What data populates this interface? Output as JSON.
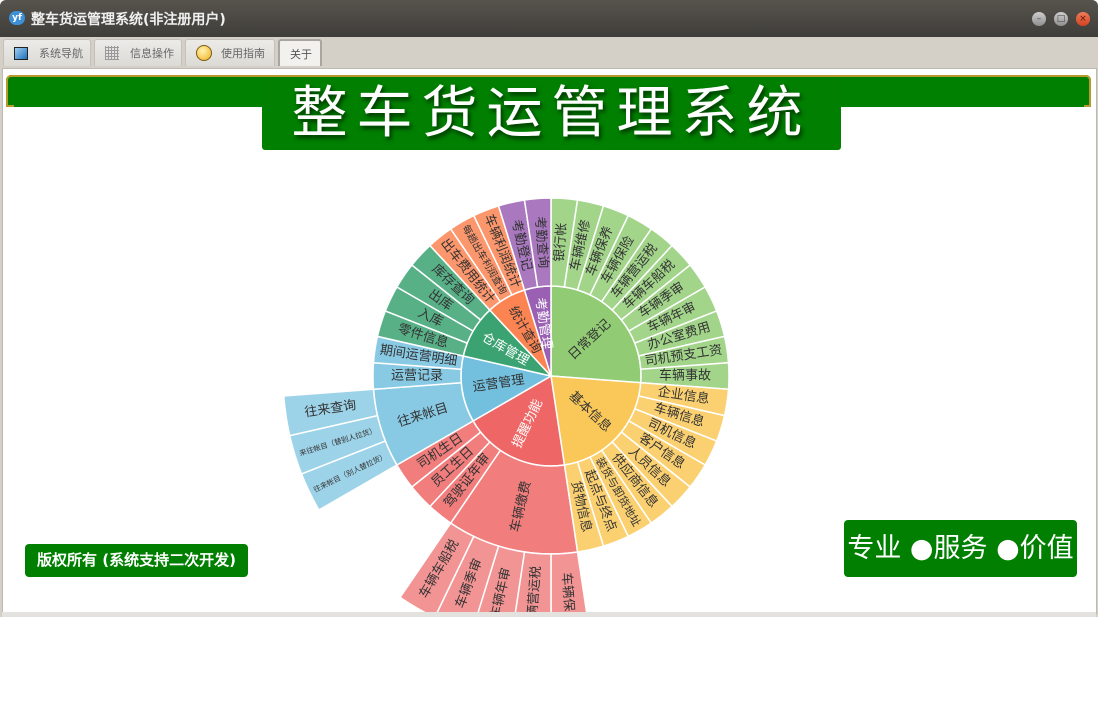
{
  "window": {
    "title": "整车货运管理系统(非注册用户)",
    "app_icon": "yf-cloud-icon",
    "controls": [
      "minimize",
      "maximize",
      "close"
    ]
  },
  "tabs": [
    {
      "label": "系统导航",
      "icon": "monitor-icon",
      "active": false
    },
    {
      "label": "信息操作",
      "icon": "grid-icon",
      "active": false
    },
    {
      "label": "使用指南",
      "icon": "help-coin-icon",
      "active": false
    },
    {
      "label": "关于",
      "icon": "",
      "active": true
    }
  ],
  "header": {
    "title": "整车货运管理系统"
  },
  "footer": {
    "copyright": "版权所有 (系统支持二次开发)",
    "slogan": "专业 ●服务 ●价值"
  },
  "colors": {
    "brand_green": "#007f00"
  },
  "chart_data": {
    "type": "sunburst",
    "title": "",
    "leaf_value": 1,
    "nodes": [
      {
        "name": "日常登记",
        "color": "#91cc75",
        "children": [
          {
            "name": "银行帐"
          },
          {
            "name": "车辆维修"
          },
          {
            "name": "车辆保养"
          },
          {
            "name": "车辆保险"
          },
          {
            "name": "车辆营运税"
          },
          {
            "name": "车辆车船税"
          },
          {
            "name": "车辆季审"
          },
          {
            "name": "车辆年审"
          },
          {
            "name": "办公室费用"
          },
          {
            "name": "司机预支工资"
          },
          {
            "name": "车辆事故"
          }
        ]
      },
      {
        "name": "基本信息",
        "color": "#fac858",
        "children": [
          {
            "name": "企业信息"
          },
          {
            "name": "车辆信息"
          },
          {
            "name": "司机信息"
          },
          {
            "name": "客户信息"
          },
          {
            "name": "人员信息"
          },
          {
            "name": "供应商信息"
          },
          {
            "name": "装货与卸货地址"
          },
          {
            "name": "起点与终点"
          },
          {
            "name": "货物信息"
          }
        ]
      },
      {
        "name": "提醒功能",
        "color": "#ee6666",
        "children": [
          {
            "name": "车辆缴费",
            "children": [
              {
                "name": "车辆保险"
              },
              {
                "name": "车辆营运税"
              },
              {
                "name": "车辆年审"
              },
              {
                "name": "车辆季审"
              },
              {
                "name": "车辆车船税"
              }
            ]
          },
          {
            "name": "驾驶证年审"
          },
          {
            "name": "员工生日"
          },
          {
            "name": "司机生日"
          }
        ]
      },
      {
        "name": "运营管理",
        "color": "#73c0de",
        "children": [
          {
            "name": "往来帐目",
            "children": [
              {
                "name": "往来帐目（别人替拉货）"
              },
              {
                "name": "来往帐目（替别人拉货）"
              },
              {
                "name": "往来查询"
              }
            ]
          },
          {
            "name": "运营记录"
          },
          {
            "name": "期间运营明细"
          }
        ]
      },
      {
        "name": "仓库管理",
        "color": "#3ba272",
        "children": [
          {
            "name": "零件信息"
          },
          {
            "name": "入库"
          },
          {
            "name": "出库"
          },
          {
            "name": "库存查询"
          }
        ]
      },
      {
        "name": "统计查询",
        "color": "#fc8452",
        "children": [
          {
            "name": "出车费用统计"
          },
          {
            "name": "每趟出车利润查询"
          },
          {
            "name": "车辆利润统计"
          }
        ]
      },
      {
        "name": "考勤管理",
        "color": "#9a60b4",
        "children": [
          {
            "name": "考勤登记"
          },
          {
            "name": "考勤查询"
          }
        ]
      }
    ]
  }
}
